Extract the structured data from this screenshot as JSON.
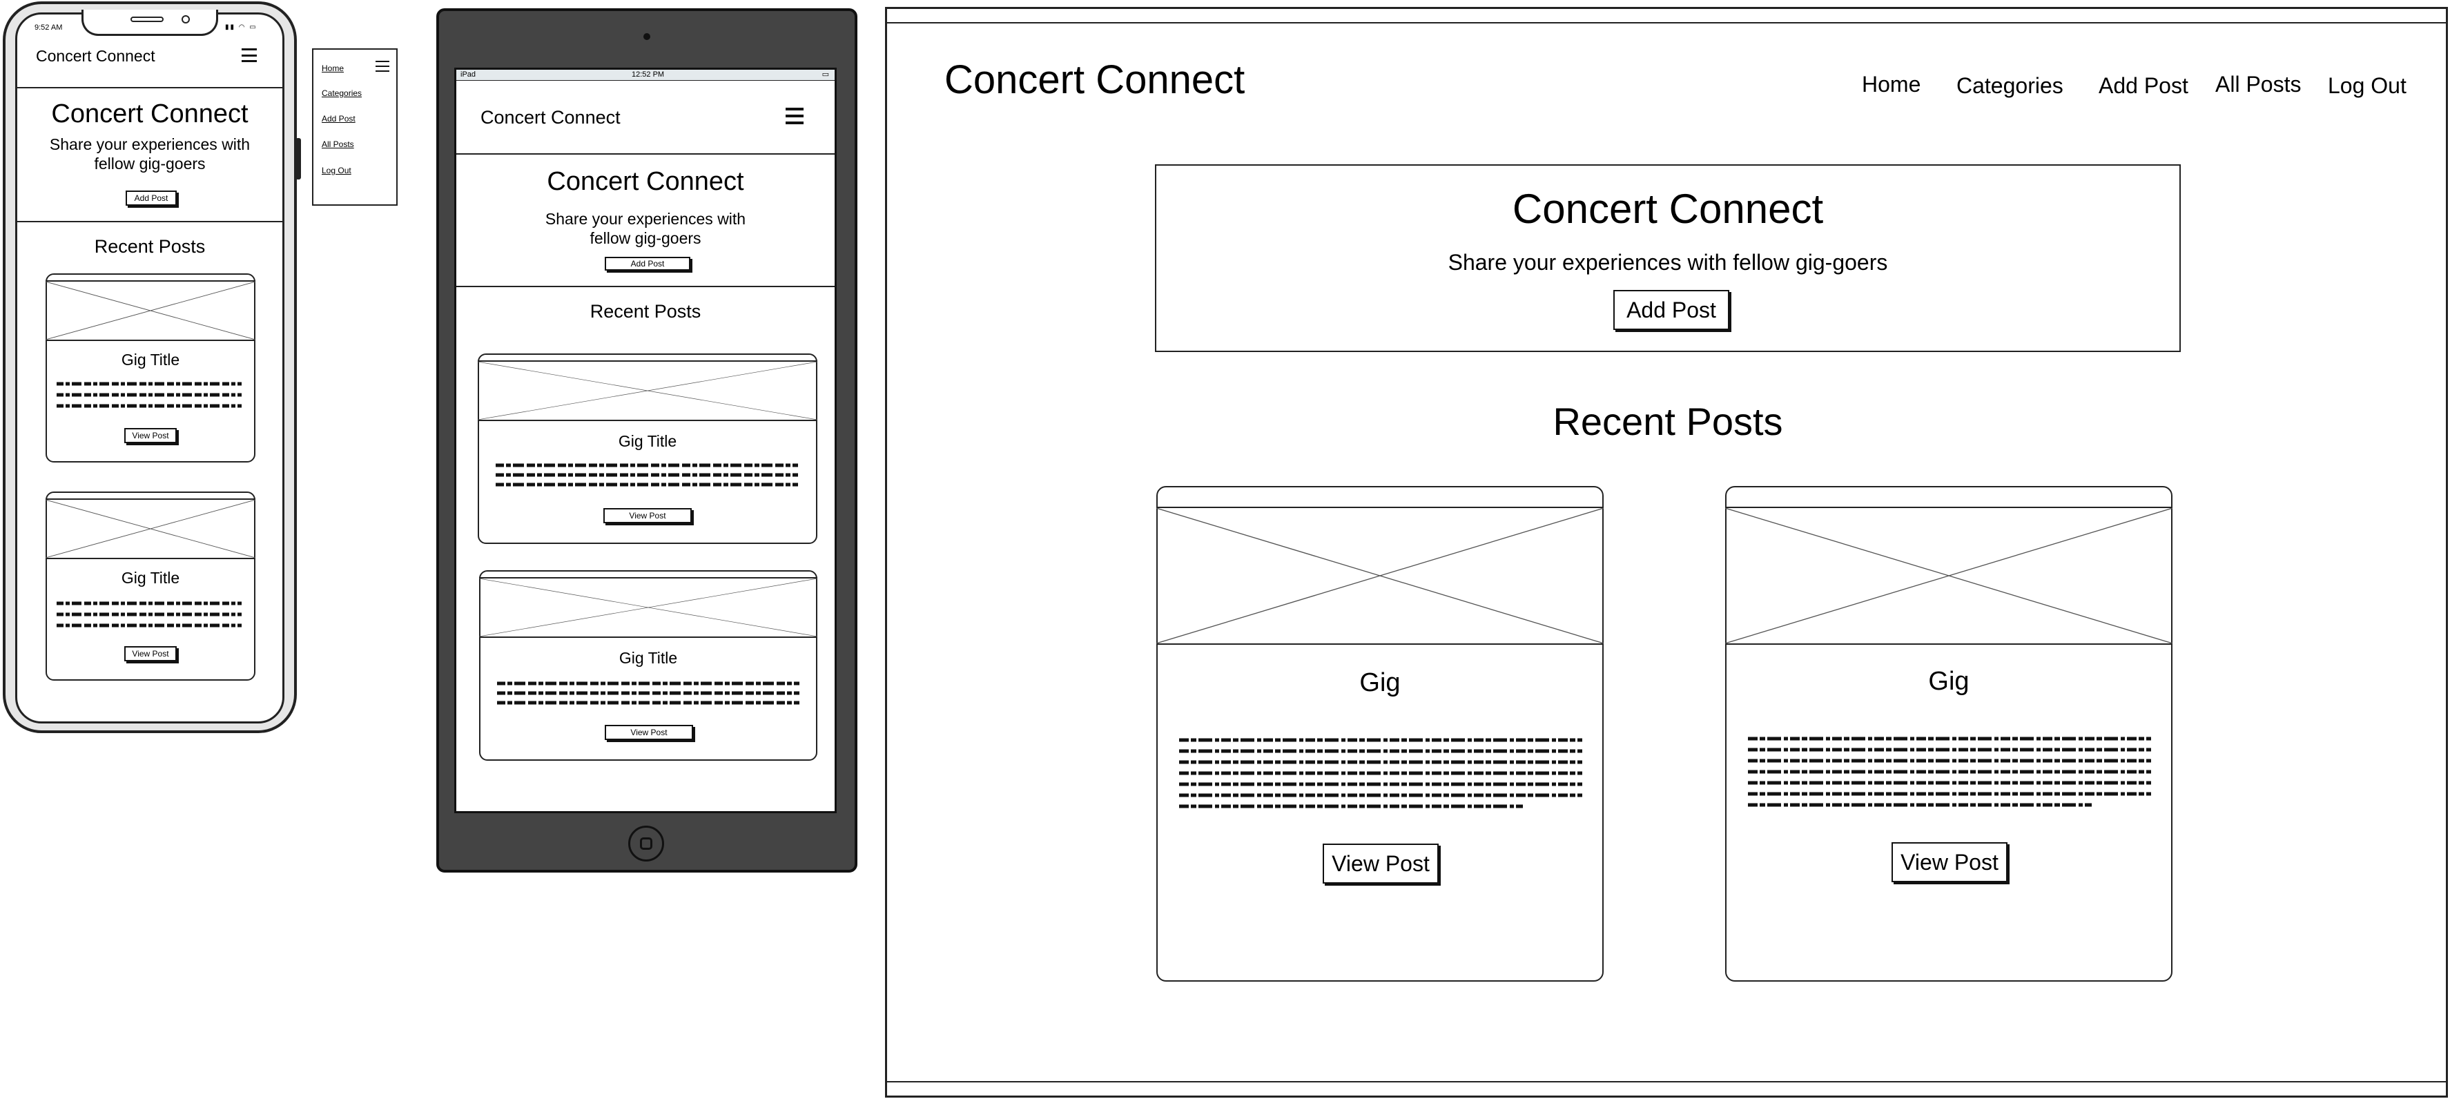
{
  "site": {
    "brand": "Concert Connect",
    "hero_title": "Concert Connect",
    "hero_subtitle": "Share your experiences with fellow gig-goers",
    "hero_subtitle_line1": "Share your experiences with",
    "hero_subtitle_line2": "fellow gig-goers",
    "add_post_label": "Add Post",
    "recent_posts_label": "Recent Posts"
  },
  "nav": {
    "items": [
      {
        "label": "Home"
      },
      {
        "label": "Categories"
      },
      {
        "label": "Add Post"
      },
      {
        "label": "All Posts"
      },
      {
        "label": "Log Out"
      }
    ]
  },
  "phone": {
    "status_time": "9:52 AM",
    "posts": [
      {
        "title": "Gig Title",
        "button": "View Post"
      },
      {
        "title": "Gig Title",
        "button": "View Post"
      }
    ]
  },
  "tablet": {
    "status_device": "iPad",
    "status_time": "12:52 PM",
    "posts": [
      {
        "title": "Gig Title",
        "button": "View Post"
      },
      {
        "title": "Gig Title",
        "button": "View Post"
      }
    ]
  },
  "desktop": {
    "posts": [
      {
        "title": "Gig",
        "button": "View Post"
      },
      {
        "title": "Gig",
        "button": "View Post"
      }
    ]
  },
  "icons": {
    "menu": "hamburger-icon",
    "image_placeholder": "image-placeholder-icon",
    "home_button": "home-button-icon"
  },
  "colors": {
    "frame_dark": "#444444",
    "stroke": "#222222",
    "placeholder_line": "#555555",
    "background": "#ffffff"
  }
}
